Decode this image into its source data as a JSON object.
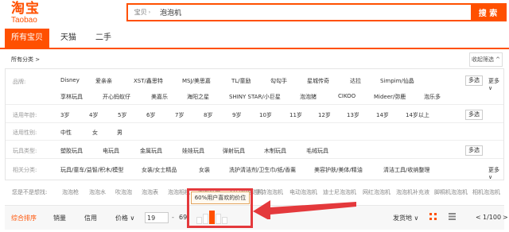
{
  "header": {
    "logo_cn": "淘宝",
    "logo_en": "Taobao",
    "search_category": "宝贝",
    "search_value": "泡泡机",
    "search_button": "搜 索"
  },
  "tabs": [
    {
      "label": "所有宝贝",
      "active": true
    },
    {
      "label": "天猫",
      "active": false
    },
    {
      "label": "二手",
      "active": false
    }
  ],
  "breadcrumb": "所有分类 >",
  "fold_button": "收起筛选 ^",
  "filters": {
    "brand": {
      "label": "品牌:",
      "row1": [
        "Disney",
        "爱亲亲",
        "XST/鑫思特",
        "MSJ/美思嘉",
        "TL/童励",
        "勾勾手",
        "星城传奇",
        "达拉",
        "Simpim/仙晶"
      ],
      "row2": [
        "享林玩具",
        "开心蚂蚁仔",
        "美嘉乐",
        "海阳之星",
        "SHINY STAR/小巨星",
        "泡泡猪",
        "CIKOO",
        "Mideer/弥鹿",
        "泡乐多"
      ],
      "multi": "多选",
      "more": "更多 ∨"
    },
    "age": {
      "label": "适用年龄:",
      "options": [
        "3岁",
        "4岁",
        "5岁",
        "6岁",
        "7岁",
        "8岁",
        "9岁",
        "10岁",
        "11岁",
        "12岁",
        "13岁",
        "14岁",
        "14岁以上"
      ],
      "multi": "多选"
    },
    "gender": {
      "label": "适用性别:",
      "options": [
        "中性",
        "女",
        "男"
      ]
    },
    "type": {
      "label": "玩具类型:",
      "options": [
        "塑胶玩具",
        "电玩具",
        "金属玩具",
        "娃娃玩具",
        "弹射玩具",
        "木制玩具",
        "毛绒玩具"
      ],
      "multi": "多选"
    },
    "related": {
      "label": "相关分类:",
      "options": [
        "玩具/童车/益智/积木/模型",
        "女装/女士精品",
        "女装",
        "洗护清洁剂/卫生巾/纸/香薰",
        "美容护肤/美体/精油",
        "清洁工具/收纳整理"
      ],
      "more": "更多 ∨"
    }
  },
  "guess": {
    "label": "您是不是想找:",
    "options": [
      "泡泡枪",
      "泡泡水",
      "吹泡泡",
      "泡泡表",
      "泡泡相机",
      "泡泡机枪",
      "全自动泡泡机",
      "手持泡泡机",
      "电动泡泡机",
      "迪士尼泡泡机",
      "网红泡泡机",
      "泡泡机补充液",
      "脚桐机泡泡机",
      "相机泡泡机"
    ]
  },
  "sortbar": {
    "items": [
      "综合排序",
      "销量",
      "信用",
      "价格 ∨"
    ],
    "price_min": "19",
    "price_sep": "-",
    "price_max": "69",
    "ship_from": "发货地 ∨",
    "pagination": "1/100",
    "prev": "<",
    "next": ">"
  },
  "price_tooltip": "60%用户喜欢的价位",
  "price_histogram": [
    0.55,
    0.75,
    1.0,
    0.75,
    0.55
  ],
  "colors": {
    "brand_orange": "#ff5000",
    "highlight_red": "#e4393c"
  }
}
